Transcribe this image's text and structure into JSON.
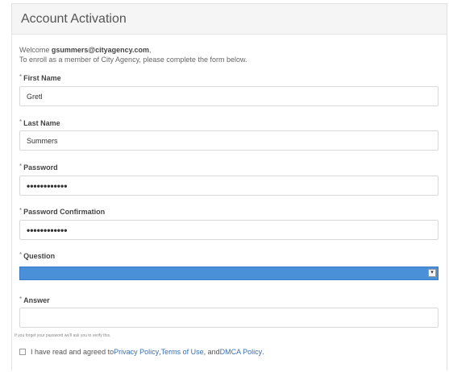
{
  "panel": {
    "title": "Account Activation"
  },
  "intro": {
    "welcome_prefix": "Welcome ",
    "email": "gsummers@cityagency.com",
    "welcome_suffix": ",",
    "line2": "To enroll as a member of  City Agency, please complete the form below."
  },
  "form": {
    "required_marker": "*",
    "first_name": {
      "label": "First Name",
      "value": "Gretl"
    },
    "last_name": {
      "label": "Last Name",
      "value": "Summers"
    },
    "password": {
      "label": "Password",
      "value": "••••••••••••"
    },
    "password_confirmation": {
      "label": "Password Confirmation",
      "value": "••••••••••••"
    },
    "question": {
      "label": "Question",
      "selected": ""
    },
    "answer": {
      "label": "Answer",
      "value": ""
    },
    "hint": "If you forget your password we'll ask you to verify this.",
    "agree": {
      "prefix": "I have read and agreed to ",
      "privacy": "Privacy Policy",
      "sep1": ", ",
      "terms": "Terms of Use",
      "sep2": ", and ",
      "dmca": "DMCA Policy",
      "suffix": "."
    }
  },
  "colors": {
    "select_highlight": "#4a90d9",
    "link": "#3a6fb0"
  },
  "icons": {
    "select_arrow": "chevron-down-icon"
  }
}
